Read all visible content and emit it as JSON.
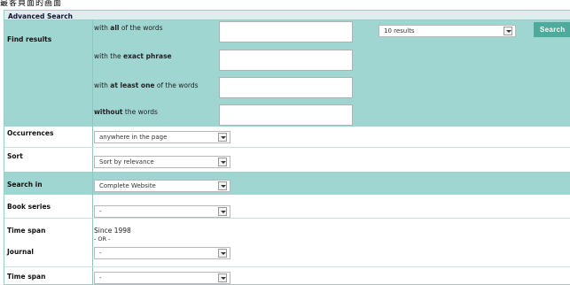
{
  "page": {
    "banner": "最客頁面的画面"
  },
  "form": {
    "title": "Advanced Search",
    "find_results_label": "Find results",
    "all_words_pre": "with ",
    "all_words_bold": "all",
    "all_words_post": " of the words",
    "exact_phrase_pre": "with the ",
    "exact_phrase_bold": "exact phrase",
    "at_least_one_pre": "with ",
    "at_least_one_bold": "at least one",
    "at_least_one_post": " of the words",
    "without_bold": "without",
    "without_post": " the words",
    "results_count": "10 results",
    "search_button": "Search",
    "occurrences_label": "Occurrences",
    "occurrences_value": "anywhere in the page",
    "sort_label": "Sort",
    "sort_value": "Sort by relevance",
    "search_in_label": "Search in",
    "search_in_value": "Complete Website",
    "book_series_label": "Book series",
    "book_series_value": "-",
    "time_span_label": "Time span",
    "time_span_value": "Since 1998",
    "or_separator": "- OR -",
    "journal_label": "Journal",
    "journal_value": "-",
    "time_span2_label": "Time span",
    "time_span2_value": "-"
  },
  "colors": {
    "teal_band": "#a0d6d1",
    "title_bar": "#dceeed",
    "search_button": "#4eaa9a"
  }
}
